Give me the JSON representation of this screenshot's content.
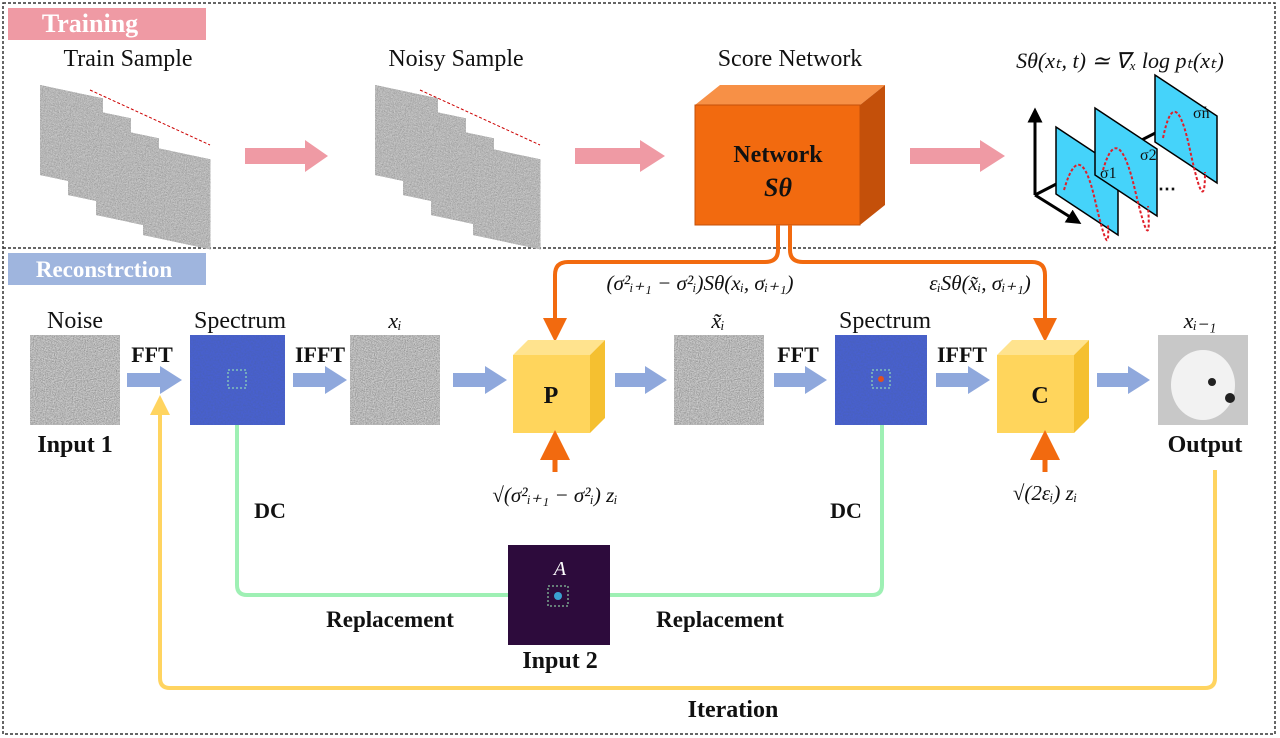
{
  "sections": {
    "training": {
      "label": "Training",
      "color": "#ef9aa4"
    },
    "reconstruction": {
      "label": "Reconstrction",
      "color": "#9fb5de"
    }
  },
  "training": {
    "train_sample": "Train Sample",
    "noisy_sample": "Noisy Sample",
    "score_network": "Score Network",
    "network_box": {
      "line1": "Network",
      "line2": "Sθ",
      "color": "#f26a0f"
    },
    "score_formula": "Sθ(xₜ, t) ≃ ∇ₓ log pₜ(xₜ)",
    "sigma_labels": [
      "σ1",
      "σ2",
      "σn"
    ],
    "arrow_color": "#ef9aa4"
  },
  "reconstruction": {
    "noise": "Noise",
    "input1": "Input 1",
    "fft1": "FFT",
    "spectrum1": "Spectrum",
    "ifft1": "IFFT",
    "xi": "xᵢ",
    "p_box": "P",
    "x_tilde": "x̃ᵢ",
    "fft2": "FFT",
    "spectrum2": "Spectrum",
    "ifft2": "IFFT",
    "c_box": "C",
    "x_prev": "xᵢ₋₁",
    "output": "Output",
    "p_formula": "(σ²ᵢ₊₁ − σ²ᵢ)Sθ(xᵢ, σᵢ₊₁)",
    "c_formula": "εᵢSθ(x̃ᵢ, σᵢ₊₁)",
    "p_noise": "√(σ²ᵢ₊₁ − σ²ᵢ) zᵢ",
    "c_noise": "√(2εᵢ) zᵢ",
    "dc1": "DC",
    "dc2": "DC",
    "mask_label": "A",
    "replacement1": "Replacement",
    "replacement2": "Replacement",
    "input2": "Input 2",
    "iteration": "Iteration",
    "colors": {
      "flow": "#8fa8dc",
      "orange": "#f26a0f",
      "box": "#ffd55c",
      "dc": "#9ef0b4",
      "iteration": "#ffd460"
    }
  }
}
